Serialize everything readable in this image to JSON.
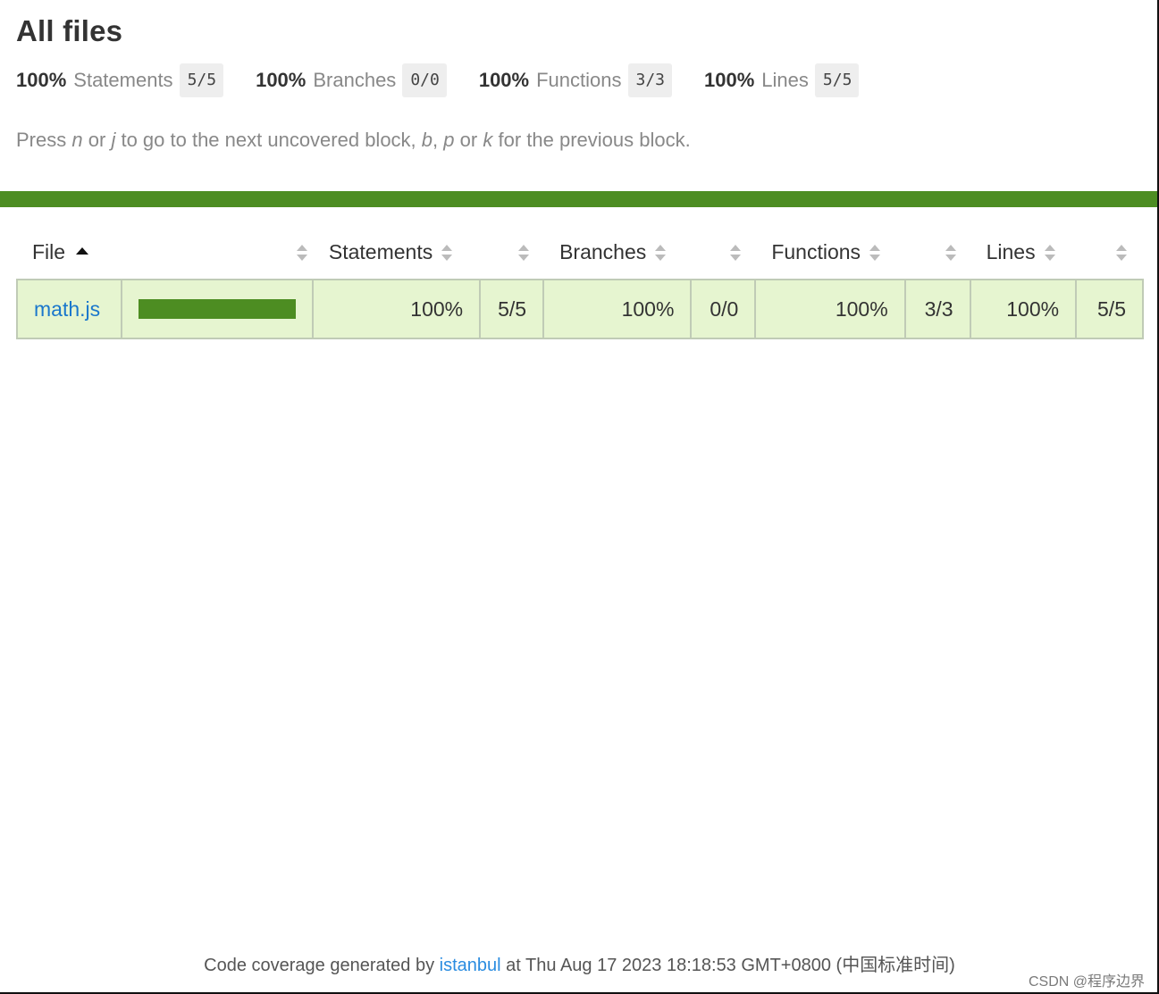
{
  "page": {
    "title": "All files",
    "hint": {
      "press": "Press",
      "n": "n",
      "or1": "or",
      "j": "j",
      "middle": "to go to the next uncovered block,",
      "b": "b",
      "comma": ",",
      "p": "p",
      "or2": "or",
      "k": "k",
      "end": "for the previous block."
    }
  },
  "summary": [
    {
      "pct": "100%",
      "label": "Statements",
      "fraction": "5/5"
    },
    {
      "pct": "100%",
      "label": "Branches",
      "fraction": "0/0"
    },
    {
      "pct": "100%",
      "label": "Functions",
      "fraction": "3/3"
    },
    {
      "pct": "100%",
      "label": "Lines",
      "fraction": "5/5"
    }
  ],
  "status_color": "#4d8d22",
  "table": {
    "headers": {
      "file": "File",
      "statements": "Statements",
      "branches": "Branches",
      "functions": "Functions",
      "lines": "Lines"
    },
    "rows": [
      {
        "file": "math.js",
        "coverage_fraction": 1.0,
        "statements_pct": "100%",
        "statements_frac": "5/5",
        "branches_pct": "100%",
        "branches_frac": "0/0",
        "functions_pct": "100%",
        "functions_frac": "3/3",
        "lines_pct": "100%",
        "lines_frac": "5/5"
      }
    ]
  },
  "footer": {
    "prefix": "Code coverage generated by",
    "link": "istanbul",
    "suffix": "at Thu Aug 17 2023 18:18:53 GMT+0800 (中国标准时间)"
  },
  "watermark": "CSDN @程序边界"
}
